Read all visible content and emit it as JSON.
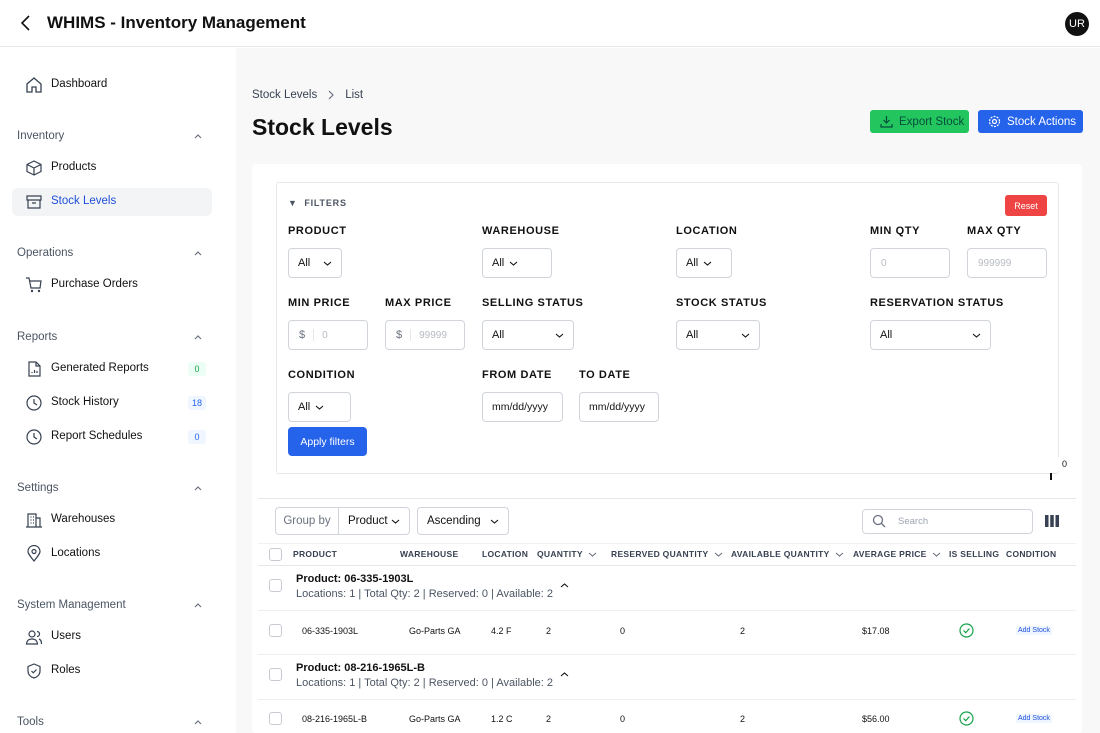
{
  "app": {
    "title": "WHIMS - Inventory Management",
    "user_initials": "UR"
  },
  "sidebar": {
    "dashboard": "Dashboard",
    "sections": [
      {
        "title": "Inventory",
        "items": [
          {
            "label": "Products"
          },
          {
            "label": "Stock Levels"
          }
        ]
      },
      {
        "title": "Operations",
        "items": [
          {
            "label": "Purchase Orders"
          }
        ]
      },
      {
        "title": "Reports",
        "items": [
          {
            "label": "Generated Reports",
            "badge": "0"
          },
          {
            "label": "Stock History",
            "badge": "18"
          },
          {
            "label": "Report Schedules",
            "badge": "0"
          }
        ]
      },
      {
        "title": "Settings",
        "items": [
          {
            "label": "Warehouses"
          },
          {
            "label": "Locations"
          }
        ]
      },
      {
        "title": "System Management",
        "items": [
          {
            "label": "Users"
          },
          {
            "label": "Roles"
          }
        ]
      },
      {
        "title": "Tools",
        "items": []
      }
    ]
  },
  "breadcrumb": {
    "parent": "Stock Levels",
    "current": "List"
  },
  "page": {
    "title": "Stock Levels",
    "export_label": "Export Stock",
    "actions_label": "Stock Actions"
  },
  "filters": {
    "heading": "FILTERS",
    "reset": "Reset",
    "product": {
      "label": "PRODUCT",
      "value": "All"
    },
    "warehouse": {
      "label": "WAREHOUSE",
      "value": "All"
    },
    "location": {
      "label": "LOCATION",
      "value": "All"
    },
    "min_qty": {
      "label": "MIN QTY",
      "placeholder": "0"
    },
    "max_qty": {
      "label": "MAX QTY",
      "placeholder": "999999"
    },
    "min_price": {
      "label": "MIN PRICE",
      "currency": "$",
      "placeholder": "0"
    },
    "max_price": {
      "label": "MAX PRICE",
      "currency": "$",
      "placeholder": "99999"
    },
    "selling_status": {
      "label": "SELLING STATUS",
      "value": "All"
    },
    "stock_status": {
      "label": "STOCK STATUS",
      "value": "All"
    },
    "reservation_status": {
      "label": "RESERVATION STATUS",
      "value": "All"
    },
    "condition": {
      "label": "CONDITION",
      "value": "All"
    },
    "from_date": {
      "label": "FROM DATE",
      "value": "mm/dd/yyyy"
    },
    "to_date": {
      "label": "TO DATE",
      "value": "mm/dd/yyyy"
    },
    "apply": "Apply filters",
    "count_tag": "0"
  },
  "toolbar": {
    "group_by_label": "Group by",
    "group_by_value": "Product",
    "sort_value": "Ascending",
    "search_placeholder": "Search"
  },
  "table": {
    "columns": [
      "PRODUCT",
      "WAREHOUSE",
      "LOCATION",
      "QUANTITY",
      "RESERVED QUANTITY",
      "AVAILABLE QUANTITY",
      "AVERAGE PRICE",
      "IS SELLING",
      "CONDITION"
    ],
    "groups": [
      {
        "title": "Product: 06-335-1903L",
        "summary": "Locations: 1 | Total Qty: 2 | Reserved: 0 | Available: 2",
        "row": {
          "product": "06-335-1903L",
          "warehouse": "Go-Parts GA",
          "location": "4.2 F",
          "quantity": "2",
          "reserved": "0",
          "available": "2",
          "price": "$17.08",
          "action": "Add Stock"
        }
      },
      {
        "title": "Product: 08-216-1965L-B",
        "summary": "Locations: 1 | Total Qty: 2 | Reserved: 0 | Available: 2",
        "row": {
          "product": "08-216-1965L-B",
          "warehouse": "Go-Parts GA",
          "location": "1.2 C",
          "quantity": "2",
          "reserved": "0",
          "available": "2",
          "price": "$56.00",
          "action": "Add Stock"
        }
      }
    ]
  }
}
